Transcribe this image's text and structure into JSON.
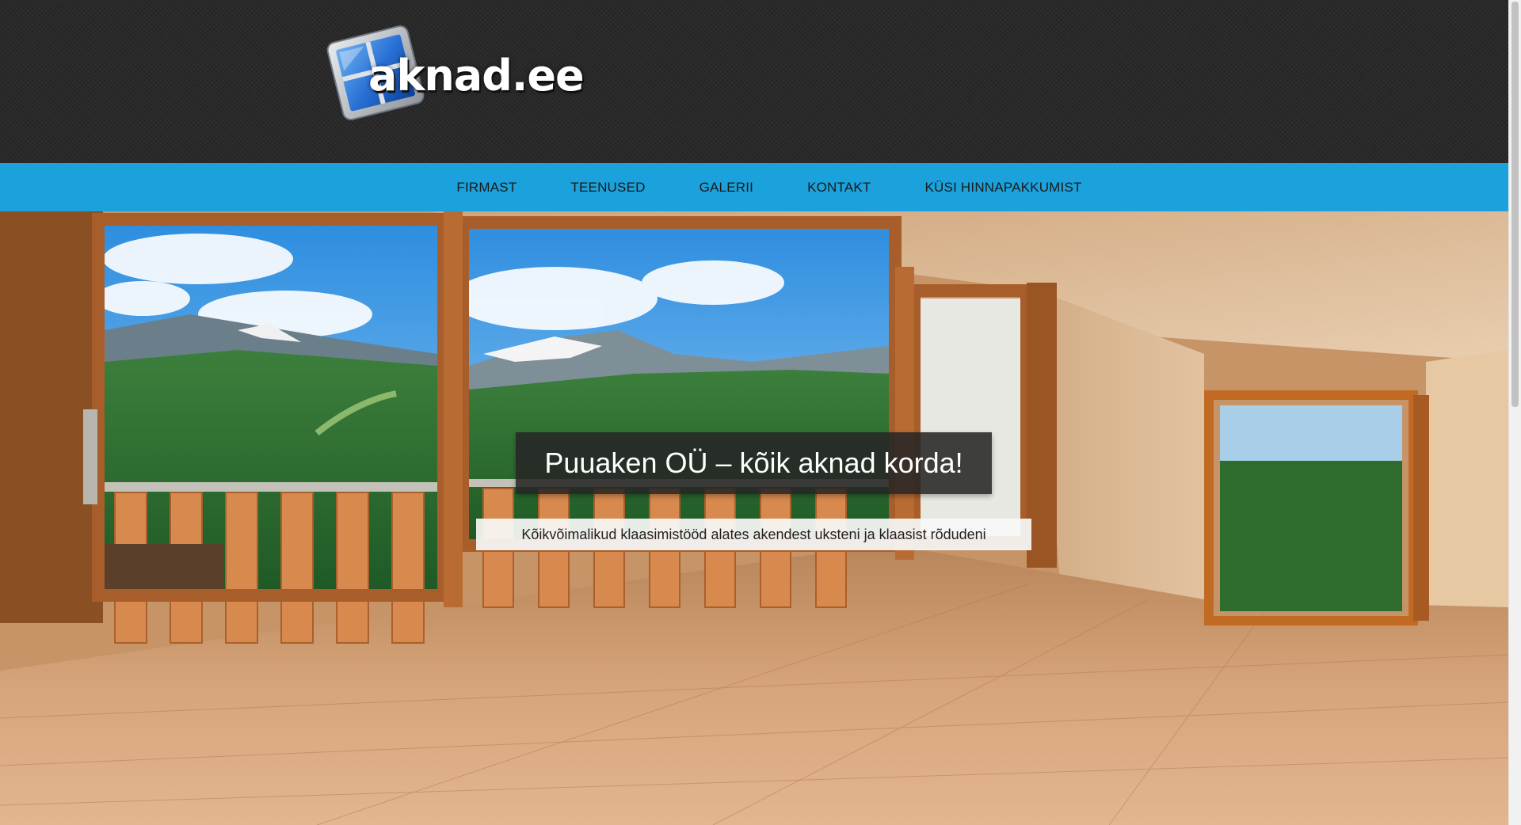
{
  "site": {
    "logo_text": "aknad.ee"
  },
  "nav": {
    "items": [
      {
        "label": "FIRMAST"
      },
      {
        "label": "TEENUSED"
      },
      {
        "label": "GALERII"
      },
      {
        "label": "KONTAKT"
      },
      {
        "label": "KÜSI HINNAPAKKUMIST"
      }
    ]
  },
  "hero": {
    "title": "Puuaken OÜ – kõik aknad korda!",
    "subtitle": "Kõikvõimalikud klaasimistööd alates akendest uksteni ja klaasist rõdudeni"
  },
  "colors": {
    "header_bg": "#262626",
    "nav_bg": "#1ba1dc",
    "nav_text": "#1a1a1a",
    "title_box_bg": "#262626",
    "subtitle_box_bg": "#f8f8f6"
  },
  "icons": {
    "logo_mark": "window-icon"
  }
}
